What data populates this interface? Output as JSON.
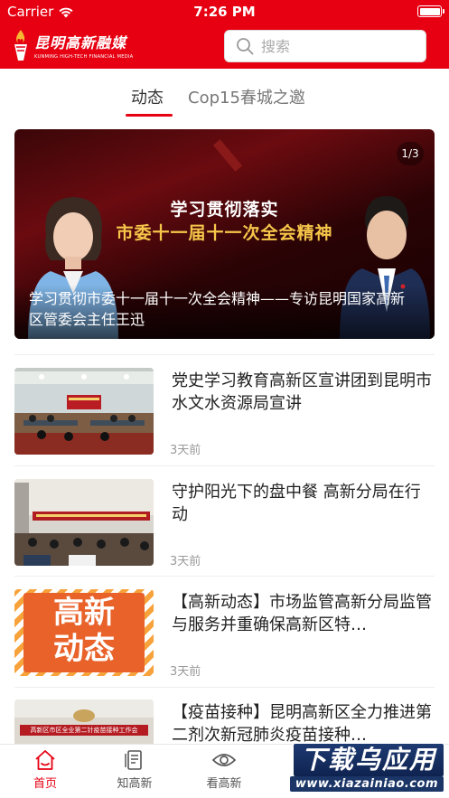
{
  "status_bar": {
    "carrier": "Carrier",
    "time": "7:26 PM"
  },
  "header": {
    "logo_cn": "昆明高新融媒",
    "logo_en": "KUNMING HIGH-TECH FINANCIAL MEDIA",
    "search_placeholder": "搜索",
    "brand_color": "#e60012"
  },
  "tabs": [
    {
      "label": "动态",
      "active": true
    },
    {
      "label": "Cop15春城之邀",
      "active": false
    }
  ],
  "banner": {
    "slogan_line1": "学习贯彻落实",
    "slogan_line2": "市委十一届十一次全会精神",
    "counter": "1/3",
    "caption": "学习贯彻市委十一届十一次全会精神——专访昆明国家高新区管委会主任王迅"
  },
  "news": [
    {
      "title": "党史学习教育高新区宣讲团到昆明市水文水资源局宣讲",
      "time": "3天前",
      "thumb": "meeting-hall"
    },
    {
      "title": "守护阳光下的盘中餐 高新分局在行动",
      "time": "3天前",
      "thumb": "conference-room"
    },
    {
      "title": "【高新动态】市场监管高新分局监管与服务并重确保高新区特…",
      "time": "3天前",
      "thumb": "tag-graphic",
      "thumb_text": [
        "高新",
        "动态"
      ]
    },
    {
      "title": "【疫苗接种】昆明高新区全力推进第二剂次新冠肺炎疫苗接种…",
      "time": "",
      "thumb": "vaccine-meeting",
      "thumb_banner": "高新区市区全业第二针疫苗接种工作会"
    }
  ],
  "tabbar": [
    {
      "label": "首页",
      "icon": "home-icon",
      "active": true
    },
    {
      "label": "知高新",
      "icon": "document-icon",
      "active": false
    },
    {
      "label": "看高新",
      "icon": "eye-icon",
      "active": false
    }
  ],
  "watermark": {
    "main": "下载乌应用",
    "url": "www.xiazainiao.com"
  }
}
